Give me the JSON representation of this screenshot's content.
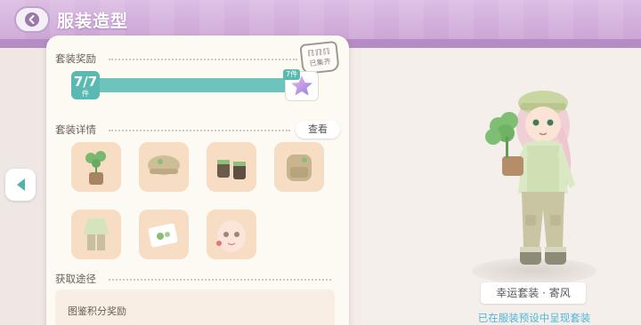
{
  "header": {
    "title": "服装造型",
    "back_icon": "back-arrow-icon"
  },
  "panel": {
    "set_reward": {
      "title": "套装奖励",
      "progress_text": "7/7",
      "progress_unit": "件",
      "progress_fraction": 1.0,
      "reward_count_label": "7件",
      "reward_icon": "purple-star-icon",
      "seal_text": "已集齐"
    },
    "set_details": {
      "title": "套装详情",
      "view_label": "查看",
      "items": [
        {
          "name": "clover-pot",
          "icon": "clover-pot-icon"
        },
        {
          "name": "beret-hat",
          "icon": "beret-hat-icon"
        },
        {
          "name": "boots",
          "icon": "boots-icon"
        },
        {
          "name": "backpack",
          "icon": "backpack-icon"
        },
        {
          "name": "outfit-suit",
          "icon": "suit-icon"
        },
        {
          "name": "socks",
          "icon": "socks-icon"
        },
        {
          "name": "face-makeup",
          "icon": "face-makeup-icon"
        }
      ]
    },
    "acquire": {
      "title": "获取途径",
      "route": "图鉴积分奖励"
    }
  },
  "showcase": {
    "outfit_name": "幸运套装 · 寄风",
    "status": "已在服装预设中呈现套装"
  },
  "colors": {
    "header_purple": "#cfa9d8",
    "teal_accent": "#5ab9b1",
    "item_bg": "#f7ddc4",
    "status_blue": "#4fb7d8"
  }
}
